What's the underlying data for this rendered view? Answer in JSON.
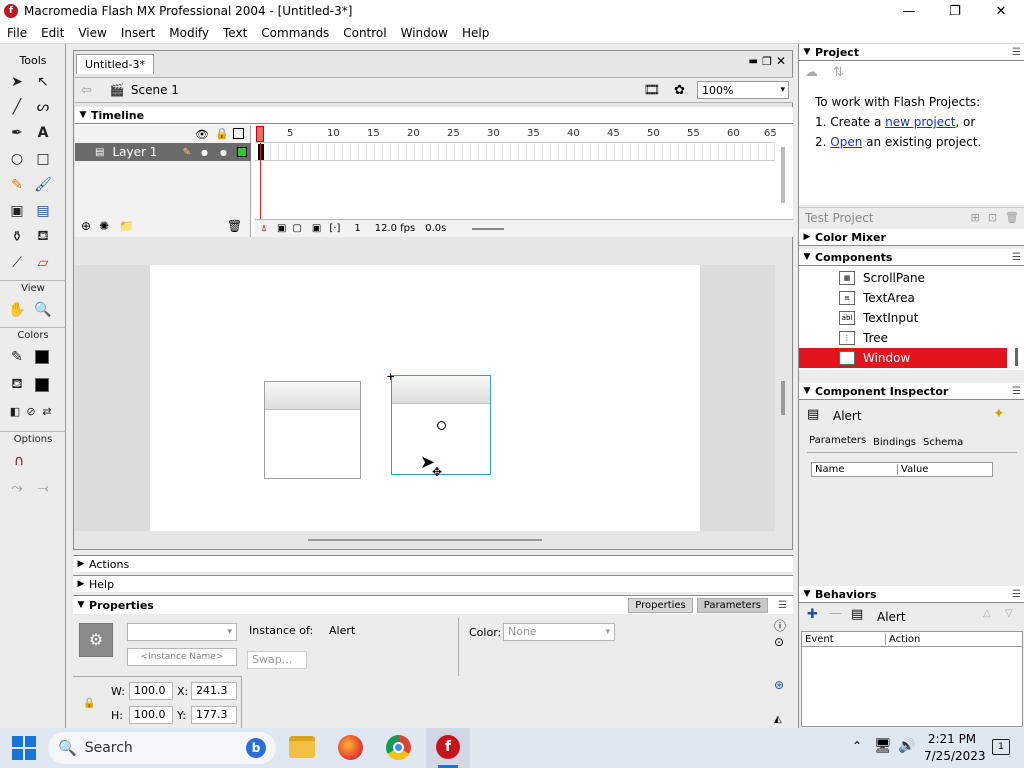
{
  "window": {
    "title": "Macromedia Flash MX Professional 2004 - [Untitled-3*]",
    "minimize": "—",
    "maximize": "❐",
    "close": "✕"
  },
  "menu": [
    "File",
    "Edit",
    "View",
    "Insert",
    "Modify",
    "Text",
    "Commands",
    "Control",
    "Window",
    "Help"
  ],
  "tools": {
    "title": "Tools",
    "view_label": "View",
    "colors_label": "Colors",
    "options_label": "Options"
  },
  "document": {
    "tab": "Untitled-3*",
    "scene": "Scene 1",
    "zoom": "100%"
  },
  "timeline": {
    "title": "Timeline",
    "layer_name": "Layer 1",
    "frame_ticks": [
      "5",
      "10",
      "15",
      "20",
      "25",
      "30",
      "35",
      "40",
      "45",
      "50",
      "55",
      "60",
      "65"
    ],
    "current_frame": "1",
    "fps": "12.0 fps",
    "elapsed": "0.0s"
  },
  "sections": {
    "actions": "Actions",
    "help": "Help"
  },
  "properties": {
    "title": "Properties",
    "tab_properties": "Properties",
    "tab_parameters": "Parameters",
    "instance_name_placeholder": "<Instance Name>",
    "instance_of_label": "Instance of:",
    "instance_of_value": "Alert",
    "swap_label": "Swap...",
    "color_label": "Color:",
    "color_value": "None",
    "w_label": "W:",
    "w_value": "100.0",
    "h_label": "H:",
    "h_value": "100.0",
    "x_label": "X:",
    "x_value": "241.3",
    "y_label": "Y:",
    "y_value": "177.3"
  },
  "project": {
    "title": "Project",
    "intro": "To work with Flash Projects:",
    "step1_prefix": "1. Create a",
    "step1_link": "new project",
    "step1_suffix": ", or",
    "step2_prefix": "2.",
    "step2_link": "Open",
    "step2_suffix": "an existing project.",
    "test_project": "Test Project"
  },
  "color_mixer": {
    "title": "Color Mixer"
  },
  "components": {
    "title": "Components",
    "items": [
      {
        "label": "ScrollPane",
        "selected": false
      },
      {
        "label": "TextArea",
        "selected": false
      },
      {
        "label": "TextInput",
        "selected": false
      },
      {
        "label": "Tree",
        "selected": false
      },
      {
        "label": "Window",
        "selected": true
      }
    ]
  },
  "component_inspector": {
    "title": "Component Inspector",
    "component": "Alert",
    "tabs": [
      "Parameters",
      "Bindings",
      "Schema"
    ],
    "col_name": "Name",
    "col_value": "Value"
  },
  "behaviors": {
    "title": "Behaviors",
    "component": "Alert",
    "col_event": "Event",
    "col_action": "Action"
  },
  "taskbar": {
    "search": "Search",
    "time": "2:21 PM",
    "date": "7/25/2023",
    "notifications": "1"
  },
  "colors": {
    "accent_selected": "#e2151f",
    "link": "#1a30c8"
  }
}
